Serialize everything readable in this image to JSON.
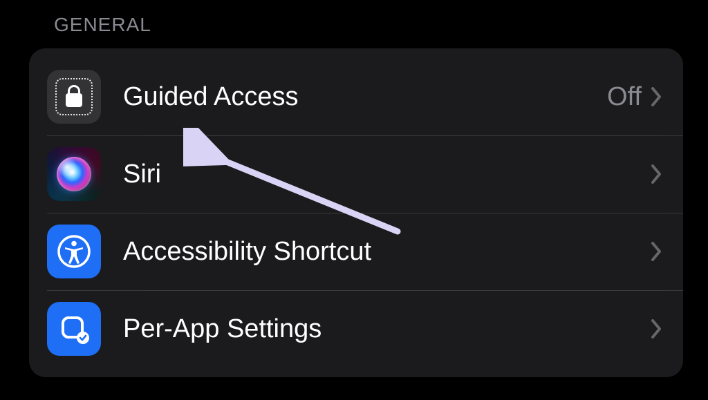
{
  "section": {
    "header": "GENERAL"
  },
  "rows": {
    "guided_access": {
      "label": "Guided Access",
      "value": "Off"
    },
    "siri": {
      "label": "Siri"
    },
    "accessibility_shortcut": {
      "label": "Accessibility Shortcut"
    },
    "per_app": {
      "label": "Per-App Settings"
    }
  },
  "colors": {
    "accent_blue": "#1e6ff6",
    "card_bg": "#1b1b1d",
    "secondary_text": "#8a8a92"
  },
  "annotation": {
    "type": "arrow",
    "target": "siri"
  }
}
